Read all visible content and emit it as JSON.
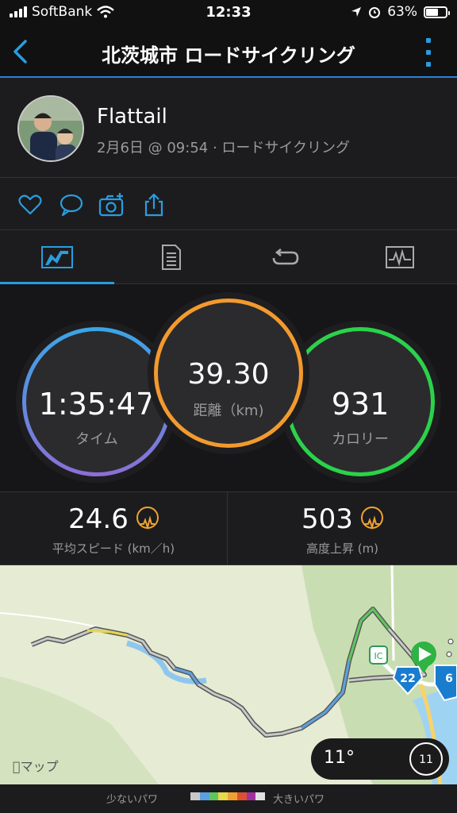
{
  "status": {
    "carrier": "SoftBank",
    "time": "12:33",
    "battery": "63%",
    "battery_level": 0.63
  },
  "nav": {
    "title": "北茨城市 ロードサイクリング"
  },
  "profile": {
    "name": "Flattail",
    "subtitle": "2月6日 @ 09:54 · ロードサイクリング"
  },
  "actions": [
    "heart-icon",
    "comment-icon",
    "camera-icon",
    "share-icon"
  ],
  "tabs": [
    "overview-tab",
    "details-tab",
    "laps-tab",
    "charts-tab"
  ],
  "stats": {
    "time": {
      "value": "1:35:47",
      "label": "タイム"
    },
    "distance": {
      "value": "39.30",
      "label": "距離（km)"
    },
    "calories": {
      "value": "931",
      "label": "カロリー"
    }
  },
  "summary": {
    "speed": {
      "value": "24.6",
      "label": "平均スピード (km／h)"
    },
    "ascent": {
      "value": "503",
      "label": "高度上昇 (m)"
    }
  },
  "map": {
    "provider": "マップ",
    "road_labels": [
      "IC",
      "22",
      "6"
    ],
    "weather_temp": "11°",
    "wind": "11"
  },
  "legend": {
    "left": "少ないパワ",
    "right": "大きいパワ",
    "colors": [
      "#c8c8c8",
      "#5aa0e0",
      "#5cc85c",
      "#e8d84a",
      "#f0a030",
      "#e05030",
      "#a030a0",
      "#e0e0e0"
    ]
  }
}
